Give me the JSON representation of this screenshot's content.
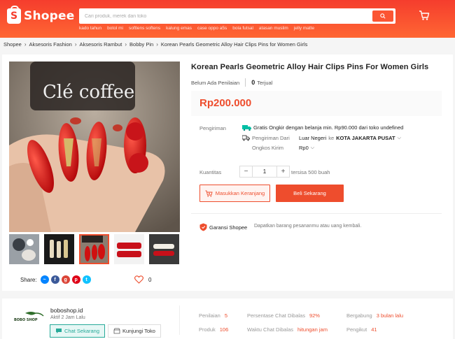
{
  "header": {
    "logo_mark": "S",
    "logo_text": "Shopee",
    "search_placeholder": "Cari produk, merek dan toko",
    "suggestions": [
      "kado tahun",
      "botol mi",
      "softlens softens",
      "kalung emas",
      "case oppo a5s",
      "bola futsal",
      "atasan muslim",
      "jelly matte"
    ]
  },
  "breadcrumb": [
    "Shopee",
    "Aksesoris Fashion",
    "Aksesoris Rambut",
    "Bobby Pin",
    "Korean Pearls Geometric Alloy Hair Clips Pins for Women Girls"
  ],
  "product": {
    "title": "Korean Pearls Geometric Alloy Hair Clips Pins For Women Girls",
    "rating_text": "Belum Ada Penilaian",
    "sold_count": "0",
    "sold_label": "Terjual",
    "price": "Rp200.000",
    "image_text": "Clé coffee",
    "shipping": {
      "label": "Pengiriman",
      "free_text": "Gratis Ongkir dengan belanja min. Rp90.000 dari toko undefined",
      "from_label": "Pengiriman Dari",
      "from_value": "Luar Negeri",
      "to_label": "ke",
      "to_value": "KOTA JAKARTA PUSAT",
      "cost_label": "Ongkos Kirim",
      "cost_value": "Rp0"
    },
    "quantity": {
      "label": "Kuantitas",
      "minus": "−",
      "value": "1",
      "plus": "+",
      "stock": "tersisa 500 buah"
    },
    "add_to_cart": "Masukkan Keranjang",
    "buy_now": "Beli Sekarang",
    "guarantee_title": "Garansi Shopee",
    "guarantee_desc": "Dapatkan barang pesananmu atau uang kembali.",
    "share_label": "Share:",
    "like_count": "0"
  },
  "shop": {
    "logo_text": "BOBO SHOP",
    "name": "boboshop.id",
    "active": "Aktif 2 Jam Lalu",
    "chat_button": "Chat Sekarang",
    "visit_button": "Kunjungi Toko",
    "stats": [
      {
        "label": "Penilaian",
        "value": "5"
      },
      {
        "label": "Produk",
        "value": "106"
      },
      {
        "label": "Persentase Chat Dibalas",
        "value": "92%"
      },
      {
        "label": "Waktu Chat Dibalas",
        "value": "hitungan jam"
      },
      {
        "label": "Bergabung",
        "value": "3 bulan lalu"
      },
      {
        "label": "Pengikut",
        "value": "41"
      }
    ]
  },
  "colors": {
    "brand": "#ee4d2d",
    "teal": "#26aa99",
    "header_gradient_top": "#f53d2d",
    "header_gradient_bottom": "#ff6633"
  }
}
